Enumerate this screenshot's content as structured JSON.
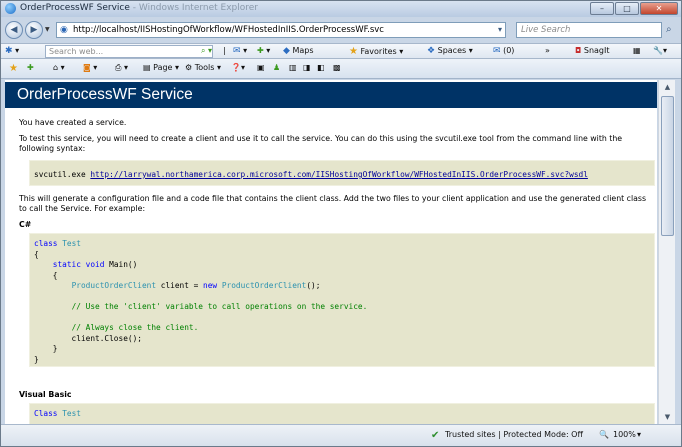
{
  "window": {
    "title": "OrderProcessWF Service",
    "title_suffix": " - Windows Internet Explorer",
    "buttons": {
      "minimize": "–",
      "maximize": "□",
      "close": "✕"
    }
  },
  "nav": {
    "back_glyph": "◀",
    "forward_glyph": "▶",
    "address": "http://localhost/IISHostingOfWorkflow/WFHostedInIIS.OrderProcessWF.svc",
    "live_search_placeholder": "Live Search"
  },
  "wl_toolbar": {
    "search_placeholder": "Search web...",
    "maps": "Maps",
    "favorites": "Favorites",
    "spaces": "Spaces",
    "mail_count": "(0)",
    "snagit": "SnagIt"
  },
  "command_bar": {
    "page": "Page",
    "tools": "Tools"
  },
  "page": {
    "header": "OrderProcessWF Service",
    "created": "You have created a service.",
    "intro": "To test this service, you will need to create a client and use it to call the service. You can do this using the svcutil.exe tool from the command line with the following syntax:",
    "svcutil_cmd": "svcutil.exe ",
    "svcutil_url": "http://larrywal.northamerica.corp.microsoft.com/IISHostingOfWorkflow/WFHostedInIIS.OrderProcessWF.svc?wsdl",
    "generate": "This will generate a configuration file and a code file that contains the client class. Add the two files to your client application and use the generated client class to call the Service. For example:",
    "csharp_label": "C#",
    "vb_label": "Visual Basic",
    "vb_first_line": "Class Test"
  },
  "status": {
    "zone": "Trusted sites | Protected Mode: Off",
    "zoom": "100%"
  }
}
